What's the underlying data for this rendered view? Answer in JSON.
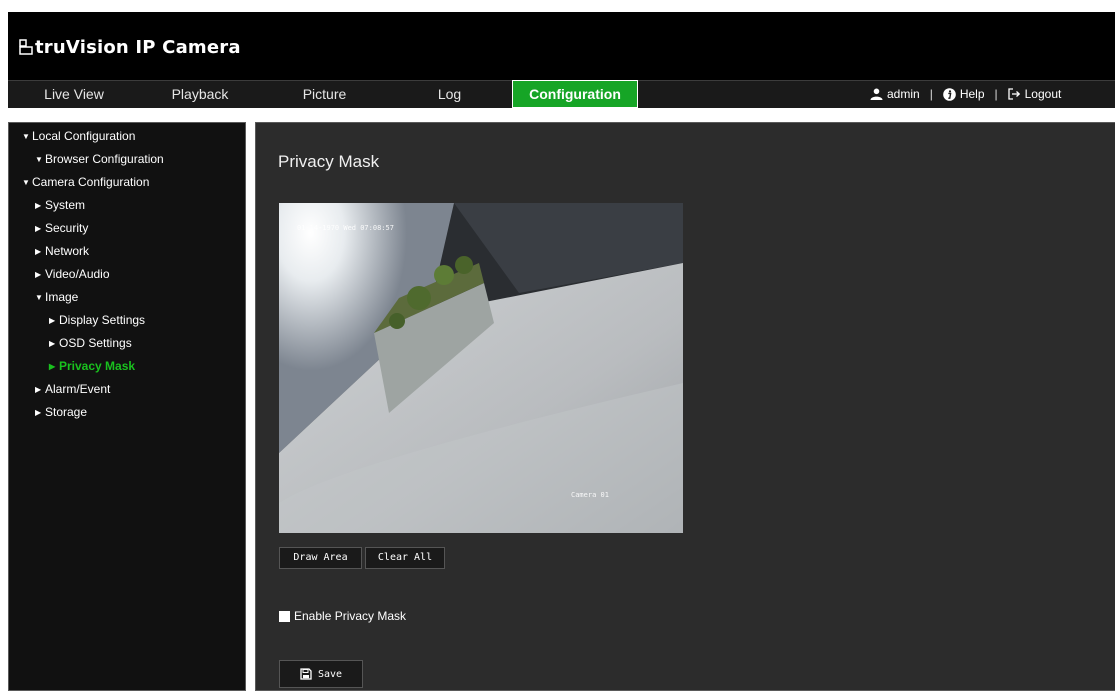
{
  "header": {
    "brand": "truVision IP Camera"
  },
  "nav": {
    "tabs": [
      {
        "label": "Live View"
      },
      {
        "label": "Playback"
      },
      {
        "label": "Picture"
      },
      {
        "label": "Log"
      },
      {
        "label": "Configuration",
        "active": true
      }
    ]
  },
  "user": {
    "name": "admin",
    "help": "Help",
    "logout": "Logout",
    "separator": "|"
  },
  "sidebar": {
    "items": [
      {
        "label": "Local Configuration",
        "icon": "triangle-down-icon"
      },
      {
        "label": "Browser Configuration",
        "icon": "triangle-down-icon"
      },
      {
        "label": "Camera Configuration",
        "icon": "triangle-down-icon"
      },
      {
        "label": "System",
        "icon": "triangle-right-icon"
      },
      {
        "label": "Security",
        "icon": "triangle-right-icon"
      },
      {
        "label": "Network",
        "icon": "triangle-right-icon"
      },
      {
        "label": "Video/Audio",
        "icon": "triangle-right-icon"
      },
      {
        "label": "Image",
        "icon": "triangle-down-icon"
      },
      {
        "label": "Display Settings",
        "icon": "triangle-right-icon"
      },
      {
        "label": "OSD Settings",
        "icon": "triangle-right-icon"
      },
      {
        "label": "Privacy Mask",
        "icon": "triangle-right-icon",
        "active": true
      },
      {
        "label": "Alarm/Event",
        "icon": "triangle-right-icon"
      },
      {
        "label": "Storage",
        "icon": "triangle-right-icon"
      }
    ]
  },
  "main": {
    "title": "Privacy Mask",
    "video": {
      "osd_datetime": "01-14-1970 Wed 07:08:57",
      "osd_camera": "Camera 01"
    },
    "buttons": {
      "draw_area": "Draw Area",
      "clear_all": "Clear All",
      "save": "Save"
    },
    "enable_label": "Enable Privacy Mask",
    "enable_checked": false
  },
  "colors": {
    "accent": "#16a526",
    "active_text": "#19c11e",
    "panel_bg": "#2c2c2c",
    "sidebar_bg": "#111111"
  }
}
